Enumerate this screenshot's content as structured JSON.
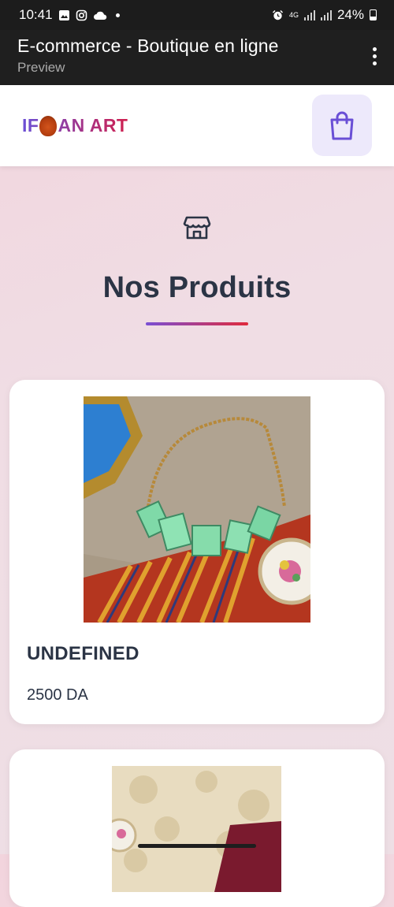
{
  "status_bar": {
    "time": "10:41",
    "network": "4G",
    "battery": "24%",
    "icons": [
      "gallery-icon",
      "instagram-icon",
      "cloud-icon",
      "notification-dot-icon",
      "alarm-icon",
      "signal-icon",
      "battery-icon"
    ]
  },
  "app_bar": {
    "title": "E-commerce - Boutique en ligne",
    "subtitle": "Preview",
    "menu_icon": "kebab-menu-icon"
  },
  "header": {
    "logo_left": "IF",
    "logo_right": "AN ART",
    "cart_icon": "shopping-bag-icon"
  },
  "section": {
    "icon": "store-icon",
    "title": "Nos Produits"
  },
  "products": [
    {
      "name": "UNDEFINED",
      "price": "2500 DA",
      "image": "green-stone-necklace-photo"
    },
    {
      "name": "",
      "price": "",
      "image": "floral-fabric-product-photo"
    }
  ],
  "colors": {
    "accent_purple": "#6a4fd6",
    "accent_red": "#e02a3c",
    "text_dark": "#2b3445",
    "cart_bg": "#ede9fb"
  }
}
